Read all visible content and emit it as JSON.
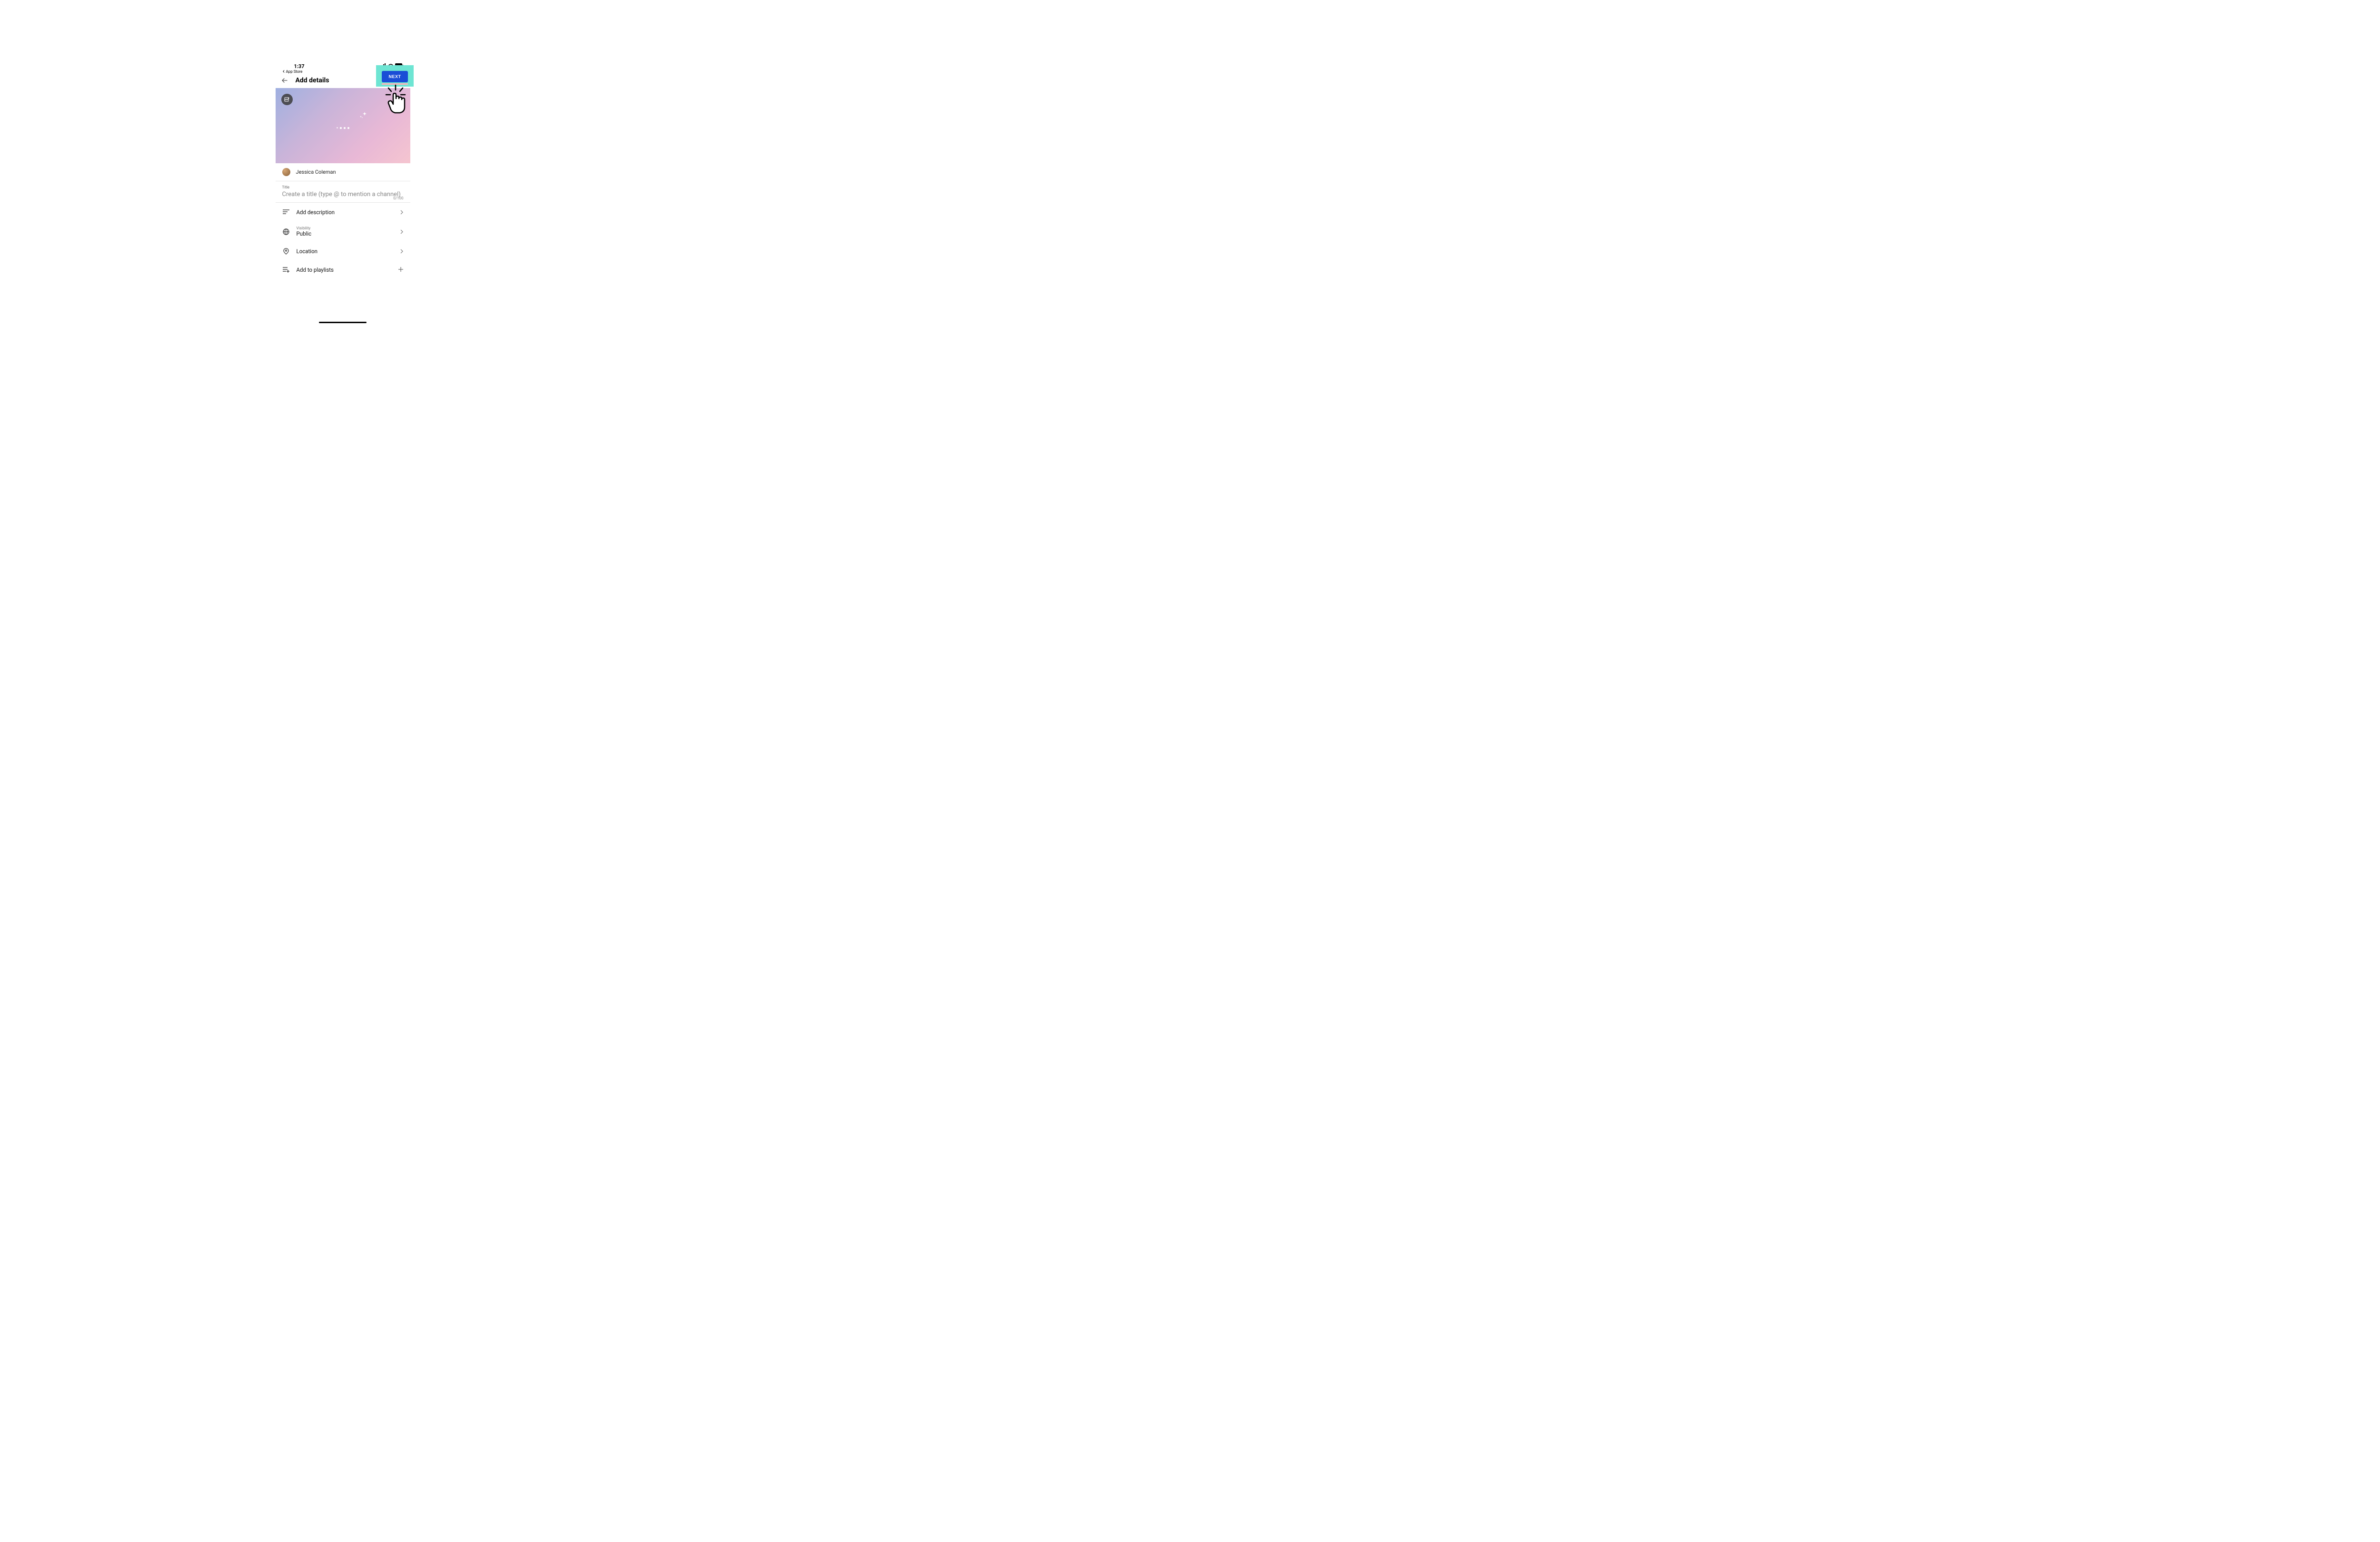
{
  "status": {
    "time": "1:37",
    "back_app": "App Store"
  },
  "header": {
    "title": "Add details",
    "next_label": "NEXT"
  },
  "channel": {
    "name": "Jessica Coleman"
  },
  "title_field": {
    "label": "Title",
    "placeholder": "Create a title (type @ to mention a channel)",
    "counter": "0/100"
  },
  "options": {
    "description": {
      "label": "Add description"
    },
    "visibility": {
      "sublabel": "Visibility",
      "value": "Public"
    },
    "location": {
      "label": "Location"
    },
    "playlists": {
      "label": "Add to playlists"
    }
  }
}
